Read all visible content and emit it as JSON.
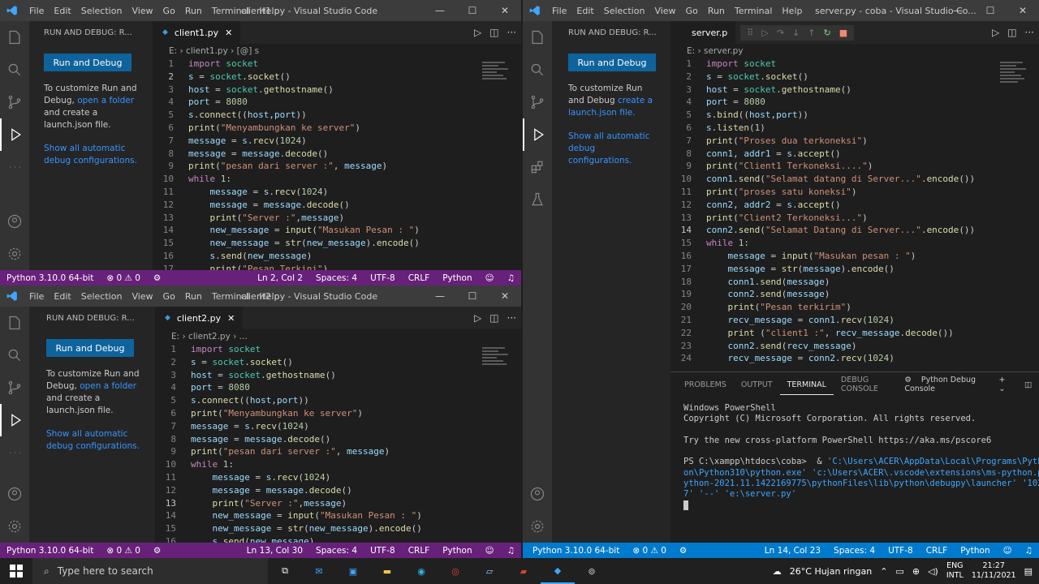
{
  "w1": {
    "menu": [
      "File",
      "Edit",
      "Selection",
      "View",
      "Go",
      "Run",
      "Terminal",
      "Help"
    ],
    "title": "client1.py - Visual Studio Code",
    "run_header": "RUN AND DEBUG: R...",
    "run_button": "Run and Debug",
    "customize": "To customize Run and Debug,",
    "open_folder": "open a folder",
    "create": "and create a launch.json file.",
    "show_all": "Show all automatic debug configurations.",
    "tab": "client1.py",
    "crumb": "E: › client1.py › [@] s",
    "status_left": [
      "Python 3.10.0 64-bit",
      "⊗ 0 ⚠ 0"
    ],
    "status_right": [
      "Ln 2, Col 2",
      "Spaces: 4",
      "UTF-8",
      "CRLF",
      "Python"
    ]
  },
  "w2": {
    "menu": [
      "File",
      "Edit",
      "Selection",
      "View",
      "Go",
      "Run",
      "Terminal",
      "Help"
    ],
    "title": "client2.py - Visual Studio Code",
    "run_header": "RUN AND DEBUG: R...",
    "run_button": "Run and Debug",
    "customize": "To customize Run and Debug,",
    "open_folder": "open a folder",
    "create": "and create a launch.json file.",
    "show_all": "Show all automatic debug configurations.",
    "tab": "client2.py",
    "crumb": "E: › client2.py › ...",
    "status_left": [
      "Python 3.10.0 64-bit",
      "⊗ 0 ⚠ 0"
    ],
    "status_right": [
      "Ln 13, Col 30",
      "Spaces: 4",
      "UTF-8",
      "CRLF",
      "Python"
    ]
  },
  "w3": {
    "menu": [
      "File",
      "Edit",
      "Selection",
      "View",
      "Go",
      "Run",
      "Terminal",
      "Help"
    ],
    "title": "server.py - coba - Visual Studio Co...",
    "run_header": "RUN AND DEBUG: R...",
    "run_button": "Run and Debug",
    "customize": "To customize Run and Debug",
    "create_link": "create a launch.json file.",
    "show_all": "Show all automatic debug configurations.",
    "tab": "server.p",
    "crumb": "E: › server.py",
    "panel_tabs": [
      "PROBLEMS",
      "OUTPUT",
      "TERMINAL",
      "DEBUG CONSOLE"
    ],
    "panel_term": "Python Debug Console",
    "status_left": [
      "Python 3.10.0 64-bit",
      "⊗ 0 ⚠ 0"
    ],
    "status_right": [
      "Ln 14, Col 23",
      "Spaces: 4",
      "UTF-8",
      "CRLF",
      "Python"
    ],
    "terminal": [
      "Windows PowerShell",
      "Copyright (C) Microsoft Corporation. All rights reserved.",
      "",
      "Try the new cross-platform PowerShell https://aka.ms/pscore6",
      "",
      "PS C:\\xampp\\htdocs\\coba>  & 'C:\\Users\\ACER\\AppData\\Local\\Programs\\Pyth",
      "on\\Python310\\python.exe' 'c:\\Users\\ACER\\.vscode\\extensions\\ms-python.p",
      "ython-2021.11.1422169775\\pythonFiles\\lib\\python\\debugpy\\launcher' '102",
      "7' '--' 'e:\\server.py'"
    ]
  },
  "code1": [
    "import socket",
    "s = socket.socket()",
    "host = socket.gethostname()",
    "port = 8080",
    "s.connect((host,port))",
    "print(\"Menyambungkan ke server\")",
    "message = s.recv(1024)",
    "message = message.decode()",
    "print(\"pesan dari server :\", message)",
    "while 1:",
    "    message = s.recv(1024)",
    "    message = message.decode()",
    "    print(\"Server :\",message)",
    "    new_message = input(\"Masukan Pesan : \")",
    "    new_message = str(new_message).encode()",
    "    s.send(new_message)",
    "    print(\"Pesan Terkini\")"
  ],
  "code2": [
    "import socket",
    "s = socket.socket()",
    "host = socket.gethostname()",
    "port = 8080",
    "s.connect((host,port))",
    "print(\"Menyambungkan ke server\")",
    "message = s.recv(1024)",
    "message = message.decode()",
    "print(\"pesan dari server :\", message)",
    "while 1:",
    "    message = s.recv(1024)",
    "    message = message.decode()",
    "    print(\"Server :\",message)",
    "    new_message = input(\"Masukan Pesan : \")",
    "    new_message = str(new_message).encode()",
    "    s.send(new_message)"
  ],
  "code3": [
    "import socket",
    "s = socket.socket()",
    "host = socket.gethostname()",
    "port = 8080",
    "s.bind((host,port))",
    "s.listen(1)",
    "print(\"Proses dua terkoneksi\")",
    "conn1, addr1 = s.accept()",
    "print(\"Client1 Terkoneksi....\")",
    "conn1.send(\"Selamat datang di Server...\".encode())",
    "print(\"proses satu koneksi\")",
    "conn2, addr2 = s.accept()",
    "print(\"Client2 Terkoneksi...\")",
    "conn2.send(\"Selamat Datang di Server...\".encode())",
    "while 1:",
    "    message = input(\"Masukan pesan : \")",
    "    message = str(message).encode()",
    "    conn1.send(message)",
    "    conn2.send(message)",
    "    print(\"Pesan terkirim\")",
    "    recv_message = conn1.recv(1024)",
    "    print (\"client1 :\", recv_message.decode())",
    "    conn2.send(recv_message)",
    "    recv_message = conn2.recv(1024)"
  ],
  "taskbar": {
    "search": "Type here to search",
    "weather": "26°C  Hujan ringan",
    "lang1": "ENG",
    "lang2": "INTL",
    "time": "21:27",
    "date": "11/11/2021"
  },
  "colors": {
    "status_purple": "#68217a",
    "status_blue": "#007acc"
  }
}
